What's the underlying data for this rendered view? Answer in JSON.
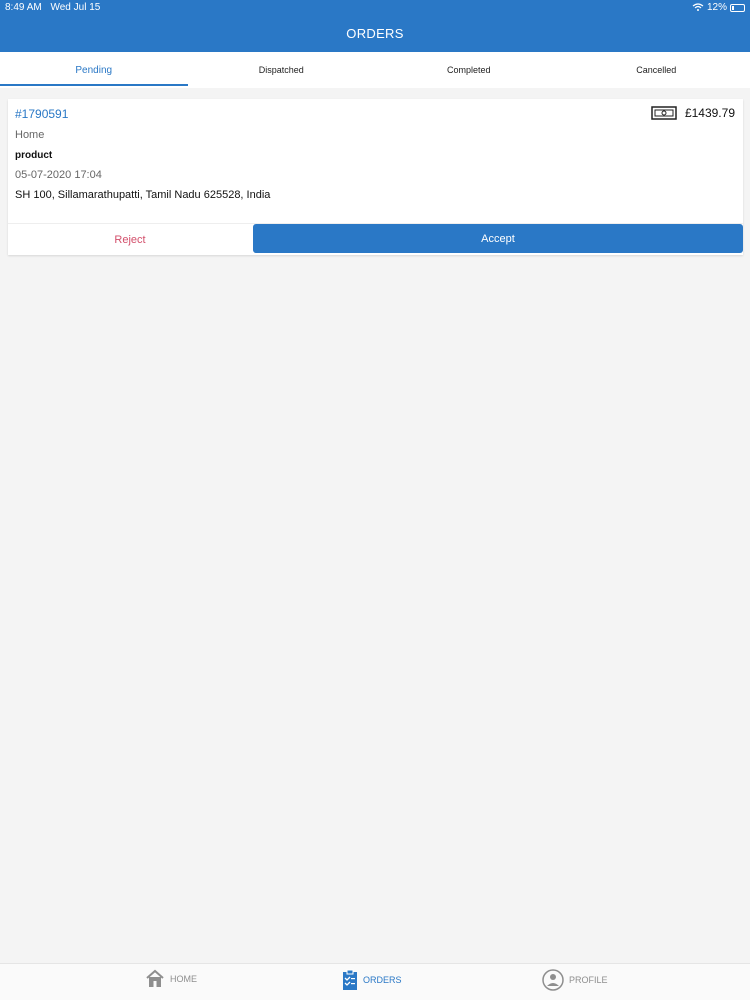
{
  "status_bar": {
    "time": "8:49 AM",
    "date": "Wed Jul 15",
    "battery": "12%"
  },
  "header": {
    "title": "ORDERS"
  },
  "tabs": [
    {
      "label": "Pending",
      "active": true
    },
    {
      "label": "Dispatched",
      "active": false
    },
    {
      "label": "Completed",
      "active": false
    },
    {
      "label": "Cancelled",
      "active": false
    }
  ],
  "order": {
    "id": "#1790591",
    "amount": "£1439.79",
    "type": "Home",
    "item": "product",
    "datetime": "05-07-2020 17:04",
    "address": "SH 100, Sillamarathupatti, Tamil Nadu 625528, India",
    "reject_label": "Reject",
    "accept_label": "Accept"
  },
  "bottom_nav": {
    "home_label": "HOME",
    "orders_label": "ORDERS",
    "profile_label": "PROFILE"
  },
  "colors": {
    "accent": "#2a78c6",
    "reject": "#d34f6b",
    "background": "#f4f4f4"
  },
  "icons": {
    "wifi": "wifi-icon",
    "battery": "battery-icon",
    "money": "cash-icon",
    "home": "home-icon",
    "orders": "orders-icon",
    "profile": "profile-icon"
  }
}
